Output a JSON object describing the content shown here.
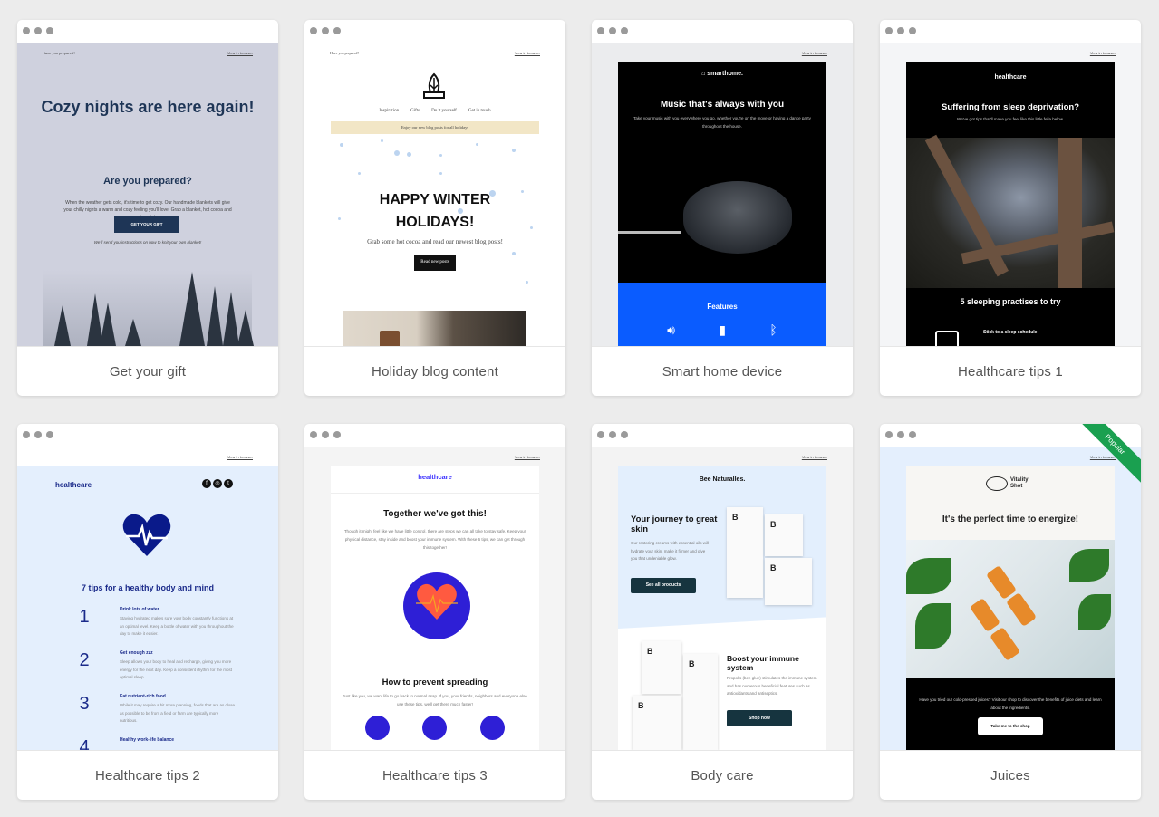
{
  "templates": [
    {
      "name": "Get your gift",
      "preview": {
        "header_left": "Have you prepared?",
        "view_in_browser": "View in browser",
        "headline": "Cozy nights are here again!",
        "subheadline": "Are you prepared?",
        "body": "When the weather gets cold, it's time to get cozy. Our handmade blankets will give your chilly nights a warm and cozy feeling you'll love. Grab a blanket, hot cocoa and enjoy winter.",
        "button": "GET YOUR GIFT",
        "note": "We'll send you instructions on how to knit your own blanket!",
        "bg_color": "#cfd1de",
        "accent_color": "#1e3556"
      }
    },
    {
      "name": "Holiday blog content",
      "preview": {
        "header_left": "Have you prepared?",
        "view_in_browser": "View in browser",
        "nav": [
          "Inspiration",
          "Gifts",
          "Do it yourself",
          "Get in touch"
        ],
        "banner": "Enjoy our new blog posts for all holidays",
        "headline": "HAPPY WINTER HOLIDAYS!",
        "body": "Grab some hot cocoa and read our newest blog posts!",
        "button": "Read new posts",
        "banner_color": "#f2e6c6"
      }
    },
    {
      "name": "Smart home device",
      "preview": {
        "view_in_browser": "View in browser",
        "brand": "smarthome.",
        "headline": "Music that's always with you",
        "body": "Take your music with you everywhere you go, whether you're on the move or having a dance party throughout the house.",
        "features_title": "Features",
        "feature_icons": [
          "speaker-volume-icon",
          "battery-charging-icon",
          "bluetooth-icon"
        ],
        "accent_color": "#0a5cff"
      }
    },
    {
      "name": "Healthcare tips 1",
      "preview": {
        "view_in_browser": "View in browser",
        "brand": "healthcare",
        "headline": "Suffering from sleep deprivation?",
        "body": "We've got tips that'll make you feel like this little fella below.",
        "subheadline": "5 sleeping practises to try",
        "tip_title": "Stick to a sleep schedule"
      }
    },
    {
      "name": "Healthcare tips 2",
      "preview": {
        "view_in_browser": "View in browser",
        "brand": "healthcare",
        "social_icons": [
          "facebook-icon",
          "instagram-icon",
          "twitter-icon"
        ],
        "headline": "7 tips for a healthy body and mind",
        "tips": [
          {
            "num": "1",
            "title": "Drink lots of water",
            "body": "Staying hydrated makes sure your body constantly functions at an optimal level. Keep a bottle of water with you throughout the day to make it easier."
          },
          {
            "num": "2",
            "title": "Get enough zzz",
            "body": "Sleep allows your body to heal and recharge, giving you more energy for the next day. Keep a consistent rhythm for the most optimal sleep."
          },
          {
            "num": "3",
            "title": "Eat nutrient-rich food",
            "body": "While it may require a bit more planning, foods that are as close as possible to be from a field or farm are typically more nutritious."
          },
          {
            "num": "4",
            "title": "Healthy work-life balance",
            "body": ""
          }
        ],
        "accent_color": "#1a2a8a"
      }
    },
    {
      "name": "Healthcare tips 3",
      "preview": {
        "view_in_browser": "View in browser",
        "brand": "healthcare",
        "headline": "Together we've got this!",
        "body": "Though it might feel like we have little control, there are steps we can all take to stay safe. Keep your physical distance, stay inside and boost your immune system. With these 6 tips, we can get through this together!",
        "subheadline": "How to prevent spreading",
        "body2": "Just like you, we want life to go back to normal asap. If you, your friends, neighbors and everyone else use these tips, we'll get there much faster!",
        "accent_color": "#2e1fd6"
      }
    },
    {
      "name": "Body care",
      "preview": {
        "view_in_browser": "View in browser",
        "brand": "Bee Naturalles.",
        "headline": "Your journey to great skin",
        "body": "Our restoring creams with essential oils will hydrate your skin, make it firmer and give you that undeniable glow.",
        "button": "See all products",
        "headline2": "Boost your immune system",
        "body2": "Propolis (bee glue) stimulates the immune system and has numerous beneficial features such as antioxidants and antiseptics.",
        "button2": "Shop now",
        "product_mark": "B",
        "accent_color": "#16343f"
      }
    },
    {
      "name": "Juices",
      "badge": "Popular",
      "preview": {
        "view_in_browser": "View in browser",
        "brand_line1": "Vitality",
        "brand_line2": "Shot",
        "headline": "It's the perfect time to energize!",
        "body": "Have you tried our cold-pressed juices? Visit our shop to discover the benefits of juice diets and learn about the ingredients.",
        "button": "Take me to the shop",
        "badge_color": "#1aa050"
      }
    }
  ]
}
